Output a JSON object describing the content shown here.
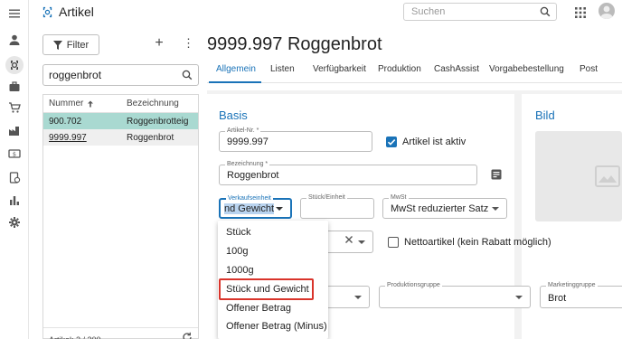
{
  "app": {
    "title": "Artikel",
    "search_placeholder": "Suchen"
  },
  "list": {
    "filter_label": "Filter",
    "plus_label": "+",
    "more_label": "⋮",
    "search_value": "roggenbrot",
    "columns": [
      "Nummer",
      "Bezeichnung"
    ],
    "rows": [
      {
        "nummer": "900.702",
        "bezeichnung": "Roggenbrotteig"
      },
      {
        "nummer": "9999.997",
        "bezeichnung": "Roggenbrot"
      }
    ],
    "footer": "Artikel: 2 / 200"
  },
  "main": {
    "title": "9999.997 Roggenbrot",
    "tabs": [
      "Allgemein",
      "Listen",
      "Verfügbarkeit",
      "Produktion",
      "CashAssist",
      "Vorgabebestellung",
      "Post"
    ],
    "active_tab": "Allgemein"
  },
  "basis": {
    "title": "Basis",
    "artikel_nr_label": "Artikel-Nr. *",
    "artikel_nr_value": "9999.997",
    "aktiv_label": "Artikel ist aktiv",
    "aktiv_checked": true,
    "bezeichnung_label": "Bezeichnung *",
    "bezeichnung_value": "Roggenbrot",
    "verkaufseinheit_label": "Verkaufseinheit",
    "verkaufseinheit_value": "nd Gewicht",
    "stueck_einheit_label": "Stück/Einheit",
    "stueck_einheit_value": "",
    "mwst_label": "MwSt",
    "mwst_value": "MwSt reduzierter Satz",
    "netto_label": "Nettoartikel (kein Rabatt möglich)",
    "netto_checked": false,
    "produktionsgruppe_label": "Produktionsgruppe",
    "produktionsgruppe_value": "",
    "marketinggruppe_label": "Marketinggruppe",
    "marketinggruppe_value": "Brot"
  },
  "bild": {
    "title": "Bild"
  },
  "dropdown": {
    "options": [
      "Stück",
      "100g",
      "1000g",
      "Stück und Gewicht",
      "Offener Betrag",
      "Offener Betrag (Minus)"
    ],
    "highlighted": "Stück und Gewicht"
  },
  "colors": {
    "accent": "#1a73b8",
    "selected_row": "#a9d9d1",
    "highlight_box": "#d9342b"
  }
}
